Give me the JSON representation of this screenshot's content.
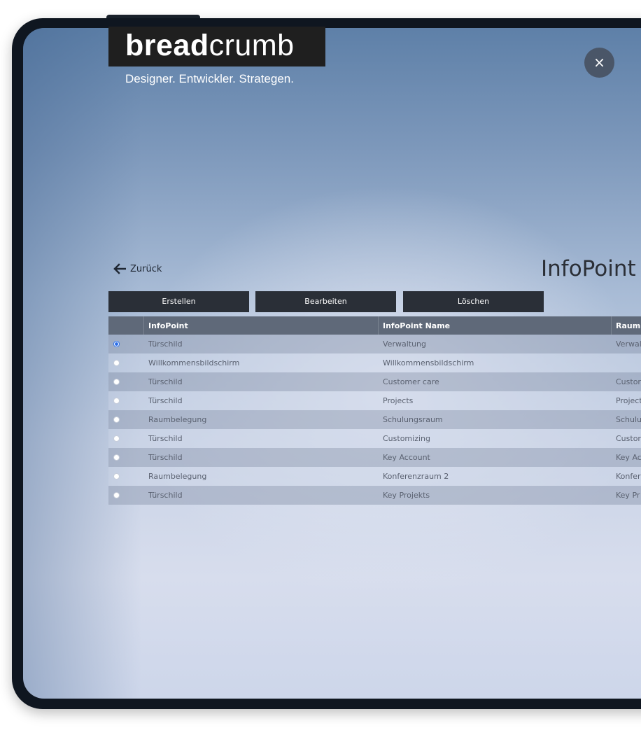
{
  "brand": {
    "name_bold": "bread",
    "name_light": "crumb",
    "tagline": "Designer. Entwickler. Strategen."
  },
  "close_label": "×",
  "back": {
    "label": "Zurück"
  },
  "page_title": "InfoPoint",
  "toolbar": {
    "create_label": "Erstellen",
    "edit_label": "Bearbeiten",
    "delete_label": "Löschen"
  },
  "table": {
    "columns": [
      "InfoPoint",
      "InfoPoint Name",
      "Raumr"
    ],
    "rows": [
      {
        "selected": true,
        "infopoint": "Türschild",
        "name": "Verwaltung",
        "room": "Verwal"
      },
      {
        "selected": false,
        "infopoint": "Willkommensbildschirm",
        "name": "Willkommensbildschirm",
        "room": ""
      },
      {
        "selected": false,
        "infopoint": "Türschild",
        "name": "Customer care",
        "room": "Custor"
      },
      {
        "selected": false,
        "infopoint": "Türschild",
        "name": "Projects",
        "room": "Project"
      },
      {
        "selected": false,
        "infopoint": "Raumbelegung",
        "name": "Schulungsraum",
        "room": "Schulu"
      },
      {
        "selected": false,
        "infopoint": "Türschild",
        "name": "Customizing",
        "room": "Custor"
      },
      {
        "selected": false,
        "infopoint": "Türschild",
        "name": "Key Account",
        "room": "Key Ac"
      },
      {
        "selected": false,
        "infopoint": "Raumbelegung",
        "name": "Konferenzraum 2",
        "room": "Konfer"
      },
      {
        "selected": false,
        "infopoint": "Türschild",
        "name": "Key Projekts",
        "room": "Key Pr"
      }
    ]
  },
  "colors": {
    "frame": "#0f1620",
    "button_bg": "#2a2f37",
    "header_bg": "#5f6979",
    "radio_accent": "#2d6fe8"
  }
}
